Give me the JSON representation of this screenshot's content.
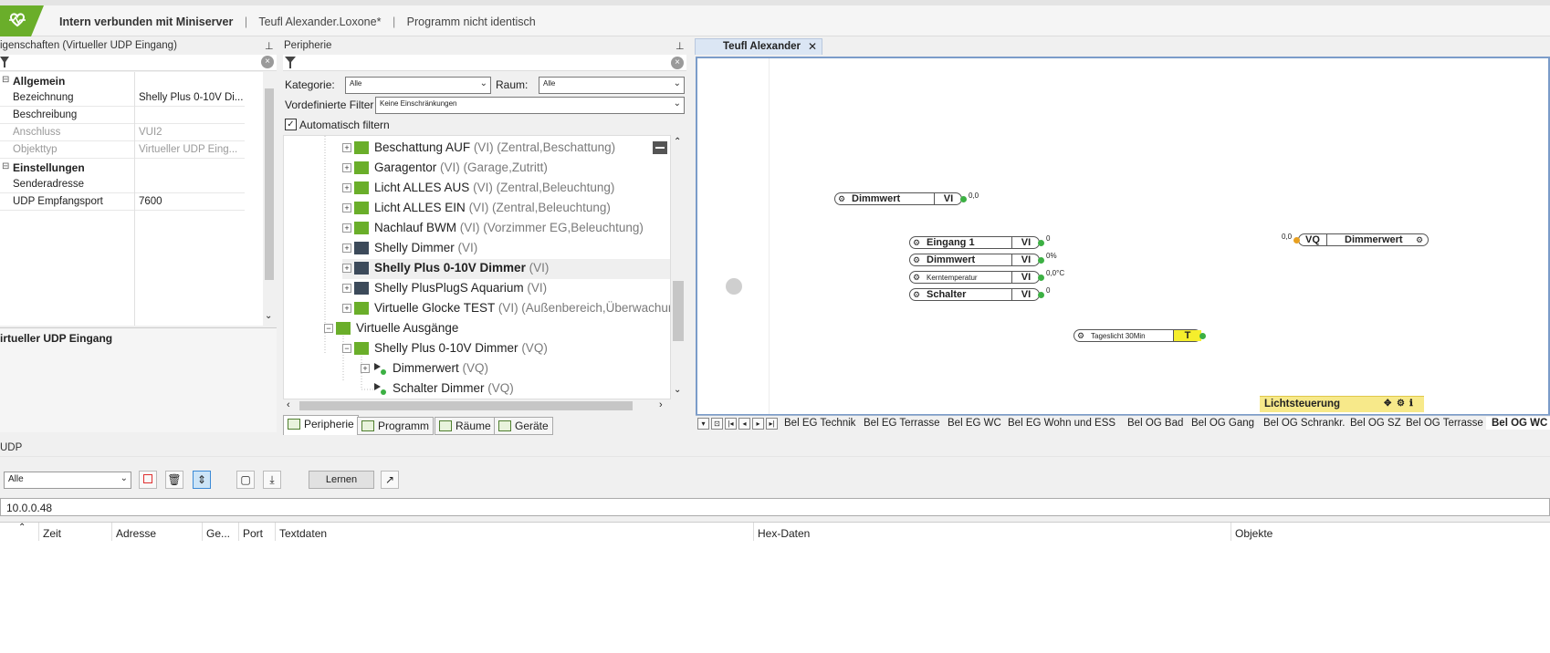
{
  "status": {
    "connection": "Intern verbunden mit Miniserver",
    "project": "Teufl Alexander.Loxone*",
    "program_state": "Programm nicht identisch",
    "separator": "|"
  },
  "properties": {
    "title": "igenschaften (Virtueller UDP Eingang)",
    "categories": {
      "general": "Allgemein",
      "settings": "Einstellungen"
    },
    "rows": [
      {
        "key": "Bezeichnung",
        "value": "Shelly Plus 0-10V Di..."
      },
      {
        "key": "Beschreibung",
        "value": ""
      },
      {
        "key": "Anschluss",
        "value": "VUI2"
      },
      {
        "key": "Objekttyp",
        "value": "Virtueller UDP Eing..."
      },
      {
        "key": "Senderadresse",
        "value": ""
      },
      {
        "key": "UDP Empfangsport",
        "value": "7600"
      }
    ],
    "description_title": "irtueller UDP Eingang"
  },
  "peripherie": {
    "title": "Peripherie",
    "kategorie_label": "Kategorie:",
    "kategorie_value": "Alle",
    "raum_label": "Raum:",
    "raum_value": "Alle",
    "filter_label": "Vordefinierte Filter",
    "filter_value": "Keine Einschränkungen",
    "auto_filter_label": "Automatisch filtern",
    "tree": [
      {
        "name": "Beschattung AUF",
        "sub": " (VI) (Zentral,Beschattung)"
      },
      {
        "name": "Garagentor",
        "sub": " (VI) (Garage,Zutritt)"
      },
      {
        "name": "Licht ALLES AUS",
        "sub": " (VI) (Zentral,Beleuchtung)"
      },
      {
        "name": "Licht ALLES EIN",
        "sub": " (VI) (Zentral,Beleuchtung)"
      },
      {
        "name": "Nachlauf BWM",
        "sub": " (VI) (Vorzimmer EG,Beleuchtung)"
      },
      {
        "name": "Shelly Dimmer",
        "sub": " (VI)"
      },
      {
        "name": "Shelly Plus 0-10V Dimmer",
        "sub": " (VI)"
      },
      {
        "name": "Shelly PlusPlugS Aquarium",
        "sub": " (VI)"
      },
      {
        "name": "Virtuelle Glocke TEST",
        "sub": " (VI) (Außenbereich,Überwachun"
      },
      {
        "name": "Virtuelle Ausgänge",
        "sub": ""
      },
      {
        "name": "Shelly Plus 0-10V Dimmer",
        "sub": " (VQ)"
      },
      {
        "name": "Dimmerwert",
        "sub": " (VQ)"
      },
      {
        "name": "Schalter Dimmer",
        "sub": " (VQ)"
      }
    ],
    "tabs": [
      "Peripherie",
      "Programm",
      "Räume",
      "Geräte"
    ]
  },
  "document": {
    "tab_title": "Teufl Alexander",
    "blocks": {
      "dimmerwert_top": {
        "label": "Dimmwert",
        "type": "VI",
        "value": "0,0"
      },
      "eingang1": {
        "label": "Eingang 1",
        "type": "VI",
        "value": "0"
      },
      "dimmwert": {
        "label": "Dimmwert",
        "type": "VI",
        "value": "0%"
      },
      "kerntemperatur": {
        "label": "Kerntemperatur",
        "type": "VI",
        "value": "0,0°C"
      },
      "schalter": {
        "label": "Schalter",
        "type": "VI",
        "value": "0"
      },
      "vq_dimmerwert": {
        "label": "Dimmerwert",
        "type": "VQ",
        "value": "0,0"
      },
      "tageslicht": {
        "label": "Tageslicht 30Min",
        "type": "T"
      }
    },
    "group_label": "Lichtsteuerung",
    "sheets": [
      "Bel EG Technik",
      "Bel EG Terrasse",
      "Bel EG WC",
      "Bel EG Wohn und ESS",
      "Bel OG Bad",
      "Bel OG Gang",
      "Bel OG Schrankr.",
      "Bel OG SZ",
      "Bel OG Terrasse",
      "Bel OG WC"
    ]
  },
  "udp": {
    "title": "UDP",
    "filter_value": "Alle",
    "learn_label": "Lernen",
    "ip_value": "10.0.0.48",
    "columns": [
      "Zeit",
      "Adresse",
      "Ge...",
      "Port",
      "Textdaten",
      "Hex-Daten",
      "Objekte"
    ]
  },
  "colors": {
    "accent_green": "#6aae2a",
    "canvas_border": "#7b9cc9",
    "group_yellow": "#f7e98a",
    "output_dot": "#3cb043"
  }
}
